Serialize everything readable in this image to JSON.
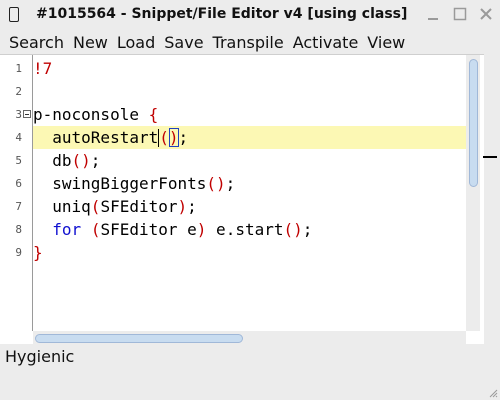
{
  "window": {
    "title": "#1015564 - Snippet/File Editor v4 [using class]",
    "icon": "phone-icon"
  },
  "menu": [
    "Search",
    "New",
    "Load",
    "Save",
    "Transpile",
    "Activate",
    "View"
  ],
  "editor": {
    "line_numbers": [
      "1",
      "2",
      "3",
      "4",
      "5",
      "6",
      "7",
      "8",
      "9"
    ],
    "current_line": 4,
    "lines": [
      [
        {
          "t": "!7",
          "c": "red"
        }
      ],
      [],
      [
        {
          "t": "p-noconsole ",
          "c": "plain"
        },
        {
          "t": "{",
          "c": "red"
        }
      ],
      [
        {
          "t": "  autoRestart",
          "c": "plain"
        },
        {
          "t": "(",
          "c": "red"
        },
        {
          "t": ")",
          "c": "red"
        },
        {
          "t": ";",
          "c": "plain"
        }
      ],
      [
        {
          "t": "  db",
          "c": "plain"
        },
        {
          "t": "()",
          "c": "red"
        },
        {
          "t": ";",
          "c": "plain"
        }
      ],
      [
        {
          "t": "  swingBiggerFonts",
          "c": "plain"
        },
        {
          "t": "()",
          "c": "red"
        },
        {
          "t": ";",
          "c": "plain"
        }
      ],
      [
        {
          "t": "  uniq",
          "c": "plain"
        },
        {
          "t": "(",
          "c": "red"
        },
        {
          "t": "SFEditor",
          "c": "plain"
        },
        {
          "t": ")",
          "c": "red"
        },
        {
          "t": ";",
          "c": "plain"
        }
      ],
      [
        {
          "t": "  ",
          "c": "plain"
        },
        {
          "t": "for",
          "c": "blue"
        },
        {
          "t": " ",
          "c": "plain"
        },
        {
          "t": "(",
          "c": "red"
        },
        {
          "t": "SFEditor e",
          "c": "plain"
        },
        {
          "t": ")",
          "c": "red"
        },
        {
          "t": " e.start",
          "c": "plain"
        },
        {
          "t": "()",
          "c": "red"
        },
        {
          "t": ";",
          "c": "plain"
        }
      ],
      [
        {
          "t": "}",
          "c": "red"
        }
      ]
    ]
  },
  "status": {
    "text": "Hygienic"
  },
  "colors": {
    "current_line_bg": "#fcf8b4",
    "keyword_red": "#c00000",
    "keyword_blue": "#1010d0",
    "scroll_thumb": "#c8dcf0"
  }
}
